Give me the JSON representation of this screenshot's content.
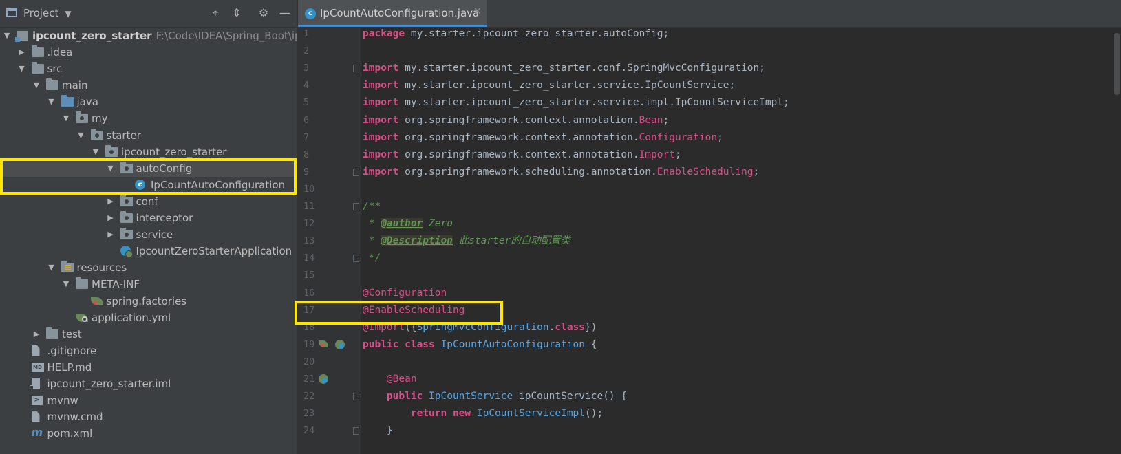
{
  "project_panel": {
    "title": "Project",
    "tree": [
      {
        "label": "ipcount_zero_starter",
        "path": "F:\\Code\\IDEA\\Spring_Boot\\ipcou",
        "depth": 0,
        "arrow": "▼",
        "icon": "module-icon",
        "bold": true
      },
      {
        "label": ".idea",
        "depth": 1,
        "arrow": "▶",
        "icon": "folder-icon"
      },
      {
        "label": "src",
        "depth": 1,
        "arrow": "▼",
        "icon": "folder-icon"
      },
      {
        "label": "main",
        "depth": 2,
        "arrow": "▼",
        "icon": "folder-icon"
      },
      {
        "label": "java",
        "depth": 3,
        "arrow": "▼",
        "icon": "source-folder-icon"
      },
      {
        "label": "my",
        "depth": 4,
        "arrow": "▼",
        "icon": "package-icon"
      },
      {
        "label": "starter",
        "depth": 5,
        "arrow": "▼",
        "icon": "package-icon"
      },
      {
        "label": "ipcount_zero_starter",
        "depth": 6,
        "arrow": "▼",
        "icon": "package-icon"
      },
      {
        "label": "autoConfig",
        "depth": 7,
        "arrow": "▼",
        "icon": "package-icon",
        "selected": true
      },
      {
        "label": "IpCountAutoConfiguration",
        "depth": 8,
        "arrow": "",
        "icon": "class-icon"
      },
      {
        "label": "conf",
        "depth": 7,
        "arrow": "▶",
        "icon": "package-icon"
      },
      {
        "label": "interceptor",
        "depth": 7,
        "arrow": "▶",
        "icon": "package-icon"
      },
      {
        "label": "service",
        "depth": 7,
        "arrow": "▶",
        "icon": "package-icon"
      },
      {
        "label": "IpcountZeroStarterApplication",
        "depth": 7,
        "arrow": "",
        "icon": "spring-boot-class-icon"
      },
      {
        "label": "resources",
        "depth": 3,
        "arrow": "▼",
        "icon": "resources-folder-icon"
      },
      {
        "label": "META-INF",
        "depth": 4,
        "arrow": "▼",
        "icon": "folder-icon"
      },
      {
        "label": "spring.factories",
        "depth": 5,
        "arrow": "",
        "icon": "spring-factories-icon"
      },
      {
        "label": "application.yml",
        "depth": 4,
        "arrow": "",
        "icon": "spring-config-icon"
      },
      {
        "label": "test",
        "depth": 2,
        "arrow": "▶",
        "icon": "folder-icon"
      },
      {
        "label": ".gitignore",
        "depth": 1,
        "arrow": "",
        "icon": "text-file-icon"
      },
      {
        "label": "HELP.md",
        "depth": 1,
        "arrow": "",
        "icon": "markdown-icon"
      },
      {
        "label": "ipcount_zero_starter.iml",
        "depth": 1,
        "arrow": "",
        "icon": "iml-file-icon"
      },
      {
        "label": "mvnw",
        "depth": 1,
        "arrow": "",
        "icon": "terminal-file-icon"
      },
      {
        "label": "mvnw.cmd",
        "depth": 1,
        "arrow": "",
        "icon": "text-file-icon"
      },
      {
        "label": "pom.xml",
        "depth": 1,
        "arrow": "",
        "icon": "maven-icon"
      }
    ]
  },
  "editor": {
    "tab": {
      "label": "IpCountAutoConfiguration.java",
      "icon": "class-icon",
      "close": "✕"
    },
    "lines": [
      {
        "n": "1",
        "t": [
          [
            "kw2",
            "package "
          ],
          [
            "",
            "my.starter.ipcount_zero_starter.autoConfig;"
          ]
        ]
      },
      {
        "n": "2",
        "t": []
      },
      {
        "n": "3",
        "fold": true,
        "t": [
          [
            "kw2",
            "import "
          ],
          [
            "",
            "my.starter.ipcount_zero_starter.conf.SpringMvcConfiguration;"
          ]
        ]
      },
      {
        "n": "4",
        "t": [
          [
            "kw2",
            "import "
          ],
          [
            "",
            "my.starter.ipcount_zero_starter.service.IpCountService;"
          ]
        ]
      },
      {
        "n": "5",
        "t": [
          [
            "kw2",
            "import "
          ],
          [
            "",
            "my.starter.ipcount_zero_starter.service.impl.IpCountServiceImpl;"
          ]
        ]
      },
      {
        "n": "6",
        "t": [
          [
            "kw2",
            "import "
          ],
          [
            "",
            "org.springframework.context.annotation."
          ],
          [
            "pink",
            "Bean"
          ],
          [
            "",
            ";"
          ]
        ]
      },
      {
        "n": "7",
        "t": [
          [
            "kw2",
            "import "
          ],
          [
            "",
            "org.springframework.context.annotation."
          ],
          [
            "pink",
            "Configuration"
          ],
          [
            "",
            ";"
          ]
        ]
      },
      {
        "n": "8",
        "t": [
          [
            "kw2",
            "import "
          ],
          [
            "",
            "org.springframework.context.annotation."
          ],
          [
            "pink",
            "Import"
          ],
          [
            "",
            ";"
          ]
        ]
      },
      {
        "n": "9",
        "fold": true,
        "t": [
          [
            "kw2",
            "import "
          ],
          [
            "",
            "org.springframework.scheduling.annotation."
          ],
          [
            "pink",
            "EnableScheduling"
          ],
          [
            "",
            ";"
          ]
        ]
      },
      {
        "n": "10",
        "t": []
      },
      {
        "n": "11",
        "fold": true,
        "t": [
          [
            "cmt",
            "/**"
          ]
        ]
      },
      {
        "n": "12",
        "t": [
          [
            "cmt",
            " * "
          ],
          [
            "tag",
            "@author"
          ],
          [
            "cmt",
            " Zero"
          ]
        ]
      },
      {
        "n": "13",
        "t": [
          [
            "cmt",
            " * "
          ],
          [
            "tag",
            "@Description"
          ],
          [
            "cmt",
            " 此starter的自动配置类"
          ]
        ]
      },
      {
        "n": "14",
        "fold": true,
        "t": [
          [
            "cmt",
            " */"
          ]
        ]
      },
      {
        "n": "15",
        "t": []
      },
      {
        "n": "16",
        "t": [
          [
            "ann",
            "@Configuration"
          ]
        ]
      },
      {
        "n": "17",
        "t": [
          [
            "ann",
            "@EnableScheduling"
          ]
        ]
      },
      {
        "n": "18",
        "t": [
          [
            "ann",
            "@Import"
          ],
          [
            "",
            "({"
          ],
          [
            "typ",
            "SpringMvcConfiguration"
          ],
          [
            "",
            "."
          ],
          [
            "kw2",
            "class"
          ],
          [
            "",
            "})"
          ]
        ]
      },
      {
        "n": "19",
        "gutter": "bean-class",
        "t": [
          [
            "kw2",
            "public class "
          ],
          [
            "typ",
            "IpCountAutoConfiguration"
          ],
          [
            "",
            " {"
          ]
        ]
      },
      {
        "n": "20",
        "t": []
      },
      {
        "n": "21",
        "gutter": "bean",
        "t": [
          [
            "",
            "    "
          ],
          [
            "ann",
            "@Bean"
          ]
        ]
      },
      {
        "n": "22",
        "fold": true,
        "t": [
          [
            "",
            "    "
          ],
          [
            "kw2",
            "public "
          ],
          [
            "typ",
            "IpCountService"
          ],
          [
            "",
            " ipCountService() {"
          ]
        ]
      },
      {
        "n": "23",
        "t": [
          [
            "",
            "        "
          ],
          [
            "kw2",
            "return new "
          ],
          [
            "typ",
            "IpCountServiceImpl"
          ],
          [
            "",
            "();"
          ]
        ]
      },
      {
        "n": "24",
        "fold": true,
        "t": [
          [
            "",
            "    }"
          ]
        ]
      }
    ]
  },
  "colors": {
    "highlight": "#ffe600",
    "accent": "#4a88c7"
  }
}
